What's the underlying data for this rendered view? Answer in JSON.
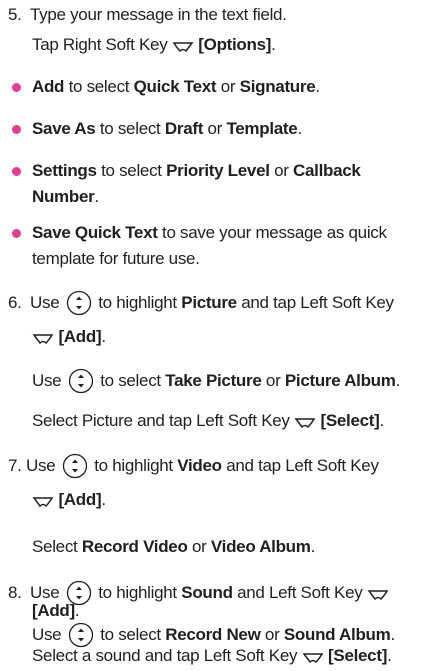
{
  "colors": {
    "text": "#231f20",
    "bullet": "#e53a96"
  },
  "step5": {
    "num": "5.",
    "line1": "Type your message in the text field.",
    "line2_pre": "Tap Right Soft Key",
    "line2_bold": "[Options]",
    "line2_post": "."
  },
  "bullets": [
    {
      "b1": "Add",
      "t1": " to select ",
      "b2": "Quick Text",
      "t2": " or ",
      "b3": "Signature",
      "t3": "."
    },
    {
      "b1": "Save As",
      "t1": " to select ",
      "b2": "Draft",
      "t2": " or ",
      "b3": "Template",
      "t3": "."
    },
    {
      "b1": "Settings",
      "t1": " to select ",
      "b2": "Priority Level",
      "t2": " or ",
      "b3": "Callback",
      "b3b": "Number",
      "t3": "."
    },
    {
      "b1": "Save Quick Text",
      "t1": " to save your message as quick",
      "line2": "template for future use."
    }
  ],
  "step6": {
    "num": "6.",
    "l1_pre": "Use",
    "l1_mid": " to highlight ",
    "l1_bold": "Picture",
    "l1_post": " and tap Left Soft Key",
    "l2_bold": "[Add]",
    "l2_post": ".",
    "l3_pre": "Use",
    "l3_mid": " to select ",
    "l3_b1": "Take Picture",
    "l3_or": " or ",
    "l3_b2": "Picture Album",
    "l3_post": ".",
    "l4_pre": "Select Picture and tap Left Soft Key",
    "l4_bold": "[Select]",
    "l4_post": "."
  },
  "step7": {
    "num": "7.",
    "l1_pre": "Use",
    "l1_mid": " to highlight ",
    "l1_bold": "Video",
    "l1_post": " and tap Left Soft Key",
    "l2_bold": "[Add]",
    "l2_post": ".",
    "l3_pre": "Select ",
    "l3_b1": "Record Video",
    "l3_or": " or ",
    "l3_b2": "Video Album",
    "l3_post": "."
  },
  "step8": {
    "num": "8.",
    "l1_pre": "Use",
    "l1_mid": " to highlight ",
    "l1_bold": "Sound",
    "l1_post": " and Left Soft Key",
    "l2_bold": "[Add]",
    "l2_post": ".",
    "l3_pre": "Use",
    "l3_mid": " to select ",
    "l3_b1": "Record New",
    "l3_or": " or ",
    "l3_b2": "Sound Album",
    "l3_post": ".",
    "l4_pre": "Select a sound and tap Left Soft Key",
    "l4_bold": "[Select]",
    "l4_post": "."
  }
}
